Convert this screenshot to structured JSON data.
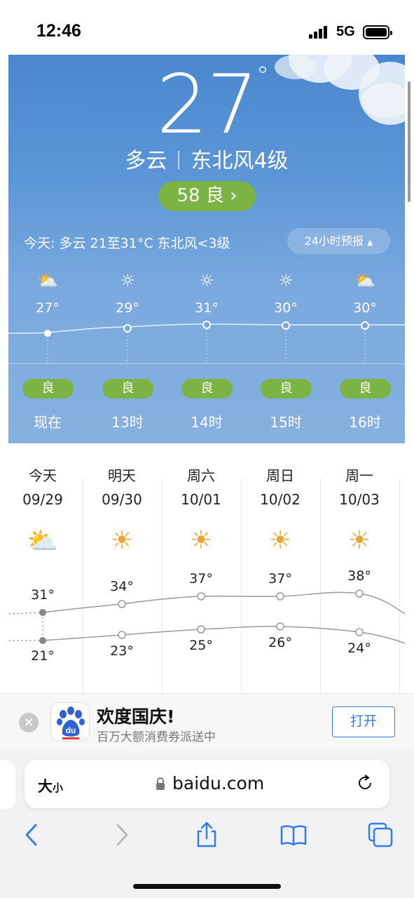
{
  "status_bar": {
    "time": "12:46",
    "network": "5G"
  },
  "current": {
    "temp": "27",
    "degree": "°",
    "condition": "多云",
    "wind": "东北风4级",
    "aqi_value": "58",
    "aqi_label": "良",
    "today_summary": "今天: 多云  21至31°C  东北风<3级",
    "forecast_toggle": "24小时预报"
  },
  "hourly": [
    {
      "icon": "partly-cloudy-icon",
      "glyph": "⛅",
      "temp": "27°",
      "aqi": "良",
      "label": "现在"
    },
    {
      "icon": "sun-icon",
      "glyph": "☼",
      "temp": "29°",
      "aqi": "良",
      "label": "13时"
    },
    {
      "icon": "sun-icon",
      "glyph": "☼",
      "temp": "31°",
      "aqi": "良",
      "label": "14时"
    },
    {
      "icon": "sun-icon",
      "glyph": "☼",
      "temp": "30°",
      "aqi": "良",
      "label": "15时"
    },
    {
      "icon": "partly-cloudy-icon",
      "glyph": "⛅",
      "temp": "30°",
      "aqi": "良",
      "label": "16时"
    }
  ],
  "daily": [
    {
      "day": "今天",
      "date": "09/29",
      "icon": "partly-cloudy-icon",
      "glyph": "⛅",
      "high": "31°",
      "low": "21°"
    },
    {
      "day": "明天",
      "date": "09/30",
      "icon": "sun-icon",
      "glyph": "☀",
      "high": "34°",
      "low": "23°"
    },
    {
      "day": "周六",
      "date": "10/01",
      "icon": "sun-icon",
      "glyph": "☀",
      "high": "37°",
      "low": "25°"
    },
    {
      "day": "周日",
      "date": "10/02",
      "icon": "sun-icon",
      "glyph": "☀",
      "high": "37°",
      "low": "26°"
    },
    {
      "day": "周一",
      "date": "10/03",
      "icon": "sun-icon",
      "glyph": "☀",
      "high": "38°",
      "low": "24°"
    }
  ],
  "banner": {
    "title": "欢度国庆!",
    "subtitle": "百万大额消费券派送中",
    "open_label": "打开",
    "app_icon_text": "du"
  },
  "browser": {
    "text_size_big": "大",
    "text_size_small": "小",
    "url": "baidu.com"
  },
  "colors": {
    "sky_top": "#4a87cf",
    "sky_bottom": "#86b0df",
    "aqi_good": "#7bb445",
    "accent_blue": "#3a7bd5"
  }
}
